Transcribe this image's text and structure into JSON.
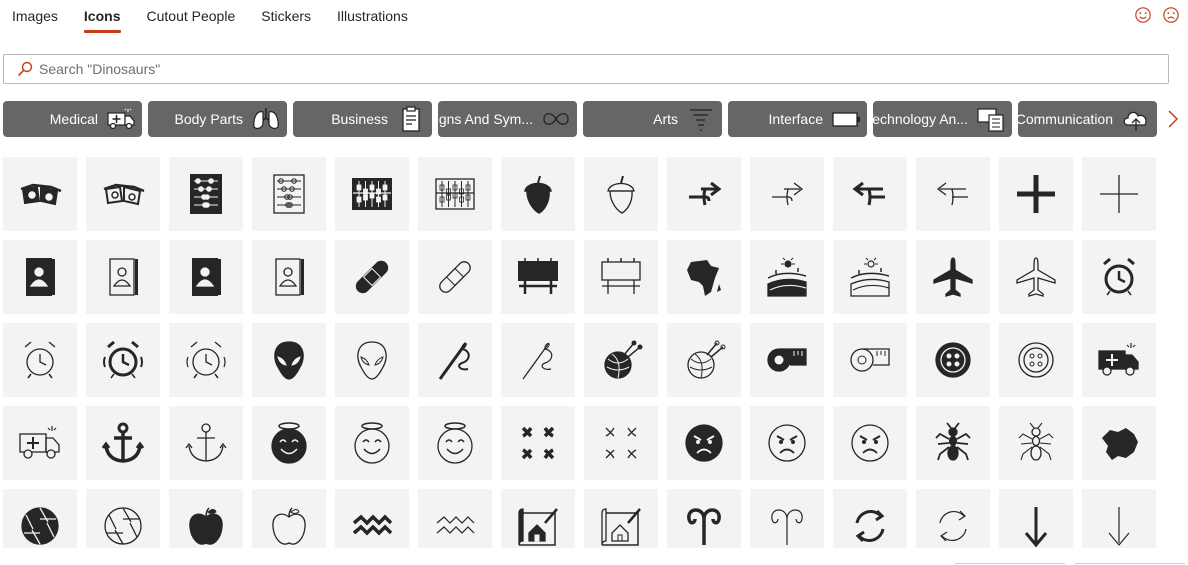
{
  "tabs": [
    {
      "label": "Images",
      "active": false
    },
    {
      "label": "Icons",
      "active": true
    },
    {
      "label": "Cutout People",
      "active": false
    },
    {
      "label": "Stickers",
      "active": false
    },
    {
      "label": "Illustrations",
      "active": false
    }
  ],
  "feedback": {
    "positive_icon": "smile-icon",
    "negative_icon": "frown-icon",
    "color": "#c43e1c"
  },
  "search": {
    "placeholder": "Search \"Dinosaurs\"",
    "value": "",
    "icon": "search-icon"
  },
  "categories": [
    {
      "label": "Medical",
      "icon": "ambulance-icon"
    },
    {
      "label": "Body Parts",
      "icon": "lungs-icon"
    },
    {
      "label": "Business",
      "icon": "clipboard-icon"
    },
    {
      "label": "Signs And Sym...",
      "icon": "infinity-icon"
    },
    {
      "label": "Arts",
      "icon": "tornado-icon"
    },
    {
      "label": "Interface",
      "icon": "battery-icon"
    },
    {
      "label": "Technology An...",
      "icon": "devices-icon"
    },
    {
      "label": "Communication",
      "icon": "cloud-upload-icon"
    }
  ],
  "icons": [
    [
      "3d-glasses-filled-icon",
      "3d-glasses-outline-icon",
      "abacus-filled-icon",
      "abacus-outline-icon",
      "abacus-filled-icon",
      "abacus-outline-icon",
      "acorn-filled-icon",
      "acorn-outline-icon",
      "arrow-right-turn-filled-icon",
      "arrow-right-turn-outline-icon",
      "arrow-left-turn-filled-icon",
      "arrow-left-turn-outline-icon",
      "plus-filled-icon",
      "plus-outline-icon"
    ],
    [
      "address-book-filled-icon",
      "address-book-outline-icon",
      "address-book-filled-icon",
      "address-book-outline-icon",
      "bandage-filled-icon",
      "bandage-outline-icon",
      "billboard-filled-icon",
      "billboard-outline-icon",
      "africa-filled-icon",
      "farm-landscape-filled-icon",
      "farm-landscape-outline-icon",
      "airplane-filled-icon",
      "airplane-outline-icon",
      "alarm-clock-filled-icon"
    ],
    [
      "alarm-clock-outline-icon",
      "alarm-ringing-filled-icon",
      "alarm-ringing-outline-icon",
      "alien-filled-icon",
      "alien-outline-icon",
      "needle-thread-filled-icon",
      "needle-thread-outline-icon",
      "yarn-filled-icon",
      "yarn-outline-icon",
      "measuring-tape-filled-icon",
      "measuring-tape-outline-icon",
      "button-filled-icon",
      "button-outline-icon",
      "ambulance-filled-icon"
    ],
    [
      "ambulance-outline-icon",
      "anchor-filled-icon",
      "anchor-outline-icon",
      "angel-face-filled-icon",
      "angel-face-outline-icon",
      "angel-face-outline-icon",
      "anger-symbol-filled-icon",
      "anger-symbol-outline-icon",
      "angry-face-filled-icon",
      "angry-face-outline-icon",
      "angry-face-outline-icon",
      "ant-filled-icon",
      "ant-outline-icon",
      "antarctica-filled-icon"
    ],
    [
      "aperture-filled-icon",
      "aperture-outline-icon",
      "apple-filled-icon",
      "apple-outline-icon",
      "aquarius-filled-icon",
      "aquarius-outline-icon",
      "architect-drawing-filled-icon",
      "architect-drawing-outline-icon",
      "aries-filled-icon",
      "aries-outline-icon",
      "arrow-circle-filled-icon",
      "arrow-circle-outline-icon",
      "arrow-down-filled-icon",
      "arrow-down-outline-icon"
    ]
  ],
  "next_categories_icon": "chevron-right-icon",
  "colors": {
    "accent": "#c43e1c",
    "category_bg": "#666666",
    "tile_bg": "#f3f3f3",
    "icon": "#262626"
  }
}
